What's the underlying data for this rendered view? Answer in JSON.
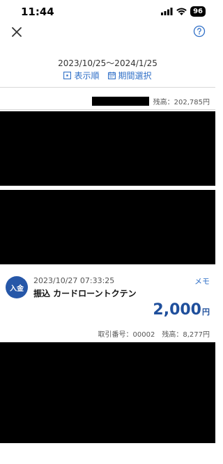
{
  "status_bar": {
    "time": "11:44",
    "battery": "96"
  },
  "header": {
    "close_icon": "close-icon",
    "help_icon": "help-icon"
  },
  "filter": {
    "period": "2023/10/25～2024/1/25",
    "sort_label": "表示順",
    "period_select_label": "期間選択"
  },
  "balance_summary": {
    "label": "残高：",
    "value": "202,785円"
  },
  "transaction": {
    "type_badge": "入金",
    "datetime": "2023/10/27 07:33:25",
    "description": "振込 カードローントクテン",
    "memo_label": "メモ",
    "amount": "2,000",
    "currency": "円",
    "ref_label": "取引番号：00002",
    "balance_label": "残高：",
    "balance_value": "8,277円"
  },
  "colors": {
    "accent": "#2f6fc7",
    "badge": "#2657a8",
    "amount": "#1f4f9c"
  }
}
